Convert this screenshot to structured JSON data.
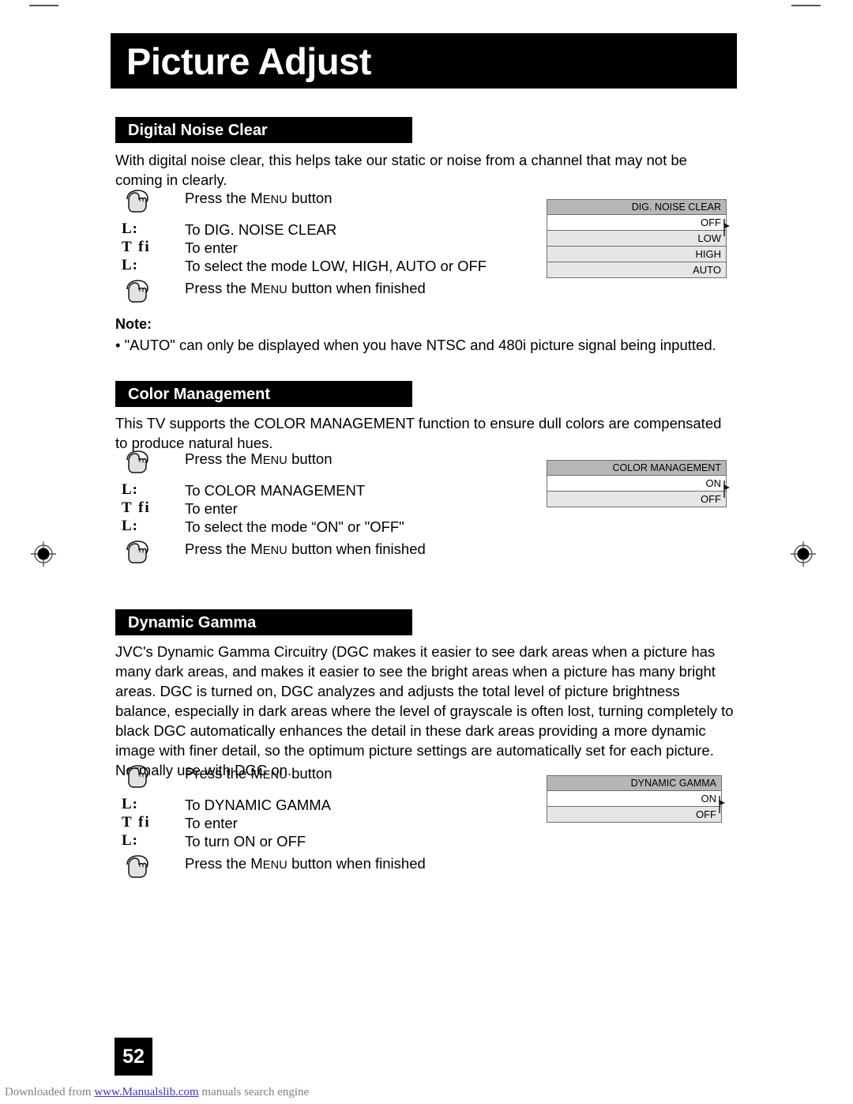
{
  "page": {
    "title": "Picture Adjust",
    "number": "52"
  },
  "icons": {
    "hand": "hand-press-icon",
    "arrow_updown": "L:",
    "arrow_enter": "T fi",
    "cursor": "menu-cursor-arrow"
  },
  "sections": [
    {
      "id": "digital-noise-clear",
      "heading": "Digital Noise Clear",
      "body": "With digital noise clear, this helps take our static or noise from a channel that may not be coming in clearly.",
      "steps": [
        {
          "icon": "hand",
          "label_prefix": "Press the ",
          "label_caps": "MENU",
          "label_suffix": " button"
        },
        {
          "icon": "arrow",
          "label": "To DIG. NOISE CLEAR"
        },
        {
          "icon": "enter",
          "label": "To enter"
        },
        {
          "icon": "arrow",
          "label": "To select the mode LOW, HIGH, AUTO or OFF"
        },
        {
          "icon": "hand",
          "label_prefix": "Press the ",
          "label_caps": "MENU",
          "label_suffix": " button when finished"
        }
      ],
      "osd": {
        "header": "DIG. NOISE CLEAR",
        "rows": [
          "OFF",
          "LOW",
          "HIGH",
          "AUTO"
        ],
        "cursor_row": 0
      },
      "note": {
        "label": "Note:",
        "items": [
          "•  \"AUTO\" can only be displayed when you have NTSC and 480i picture signal being inputted."
        ]
      }
    },
    {
      "id": "color-management",
      "heading": "Color Management",
      "body": "This TV supports the COLOR MANAGEMENT function to ensure dull colors are compensated to produce natural hues.",
      "steps": [
        {
          "icon": "hand",
          "label_prefix": "Press the ",
          "label_caps": "MENU",
          "label_suffix": " button"
        },
        {
          "icon": "arrow",
          "label": "To COLOR MANAGEMENT"
        },
        {
          "icon": "enter",
          "label": "To enter"
        },
        {
          "icon": "arrow",
          "label": "To select the mode “ON\" or \"OFF\""
        },
        {
          "icon": "hand",
          "label_prefix": "Press the ",
          "label_caps": "MENU",
          "label_suffix": " button when finished"
        }
      ],
      "osd": {
        "header": "COLOR MANAGEMENT",
        "rows": [
          "ON",
          "OFF"
        ],
        "cursor_row": 0
      }
    },
    {
      "id": "dynamic-gamma",
      "heading": "Dynamic Gamma",
      "body": "JVC's Dynamic Gamma Circuitry (DGC makes it easier to see dark areas when a picture has many dark areas, and makes it easier to see the bright areas when a picture has many bright areas.  DGC is turned on, DGC analyzes and adjusts the total level of picture brightness balance, especially in dark areas where the level of grayscale is often lost, turning completely to black DGC automatically enhances the detail in these dark areas providing a more dynamic image with finer detail, so the optimum picture settings are automatically set for each picture. Normally use with DGC on.",
      "steps": [
        {
          "icon": "hand",
          "label_prefix": "Press the ",
          "label_caps": "MENU",
          "label_suffix": " button"
        },
        {
          "icon": "arrow",
          "label": "To DYNAMIC GAMMA"
        },
        {
          "icon": "enter",
          "label": "To enter"
        },
        {
          "icon": "arrow",
          "label": "To turn ON or OFF"
        },
        {
          "icon": "hand",
          "label_prefix": "Press the ",
          "label_caps": "MENU",
          "label_suffix": " button when finished"
        }
      ],
      "osd": {
        "header": "DYNAMIC GAMMA",
        "rows": [
          "ON",
          "OFF"
        ],
        "cursor_row": 0
      }
    }
  ],
  "footer": {
    "prefix": "Downloaded from ",
    "link": "www.Manualslib.com",
    "suffix": " manuals search engine"
  },
  "colors": {
    "bar_black": "#000000",
    "osd_header_gray": "#b6b6b6",
    "osd_row_gray": "#e6e6e6",
    "osd_border": "#6e6e6e",
    "footer_link": "#3b34d6",
    "footer_text": "#808080"
  }
}
